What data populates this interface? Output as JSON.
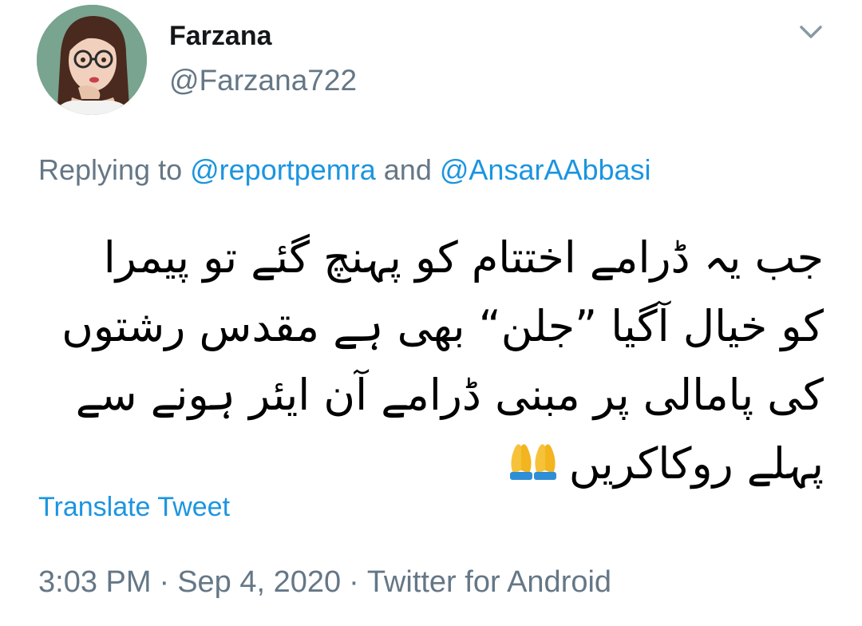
{
  "author": {
    "display_name": "Farzana",
    "handle": "@Farzana722",
    "avatar_icon": "profile-avatar"
  },
  "menu_icon": "chevron-down-icon",
  "reply": {
    "prefix": "Replying to",
    "mention_1": "@reportpemra",
    "conjunction": "and",
    "mention_2": "@AnsarAAbbasi"
  },
  "tweet": {
    "lines": [
      "جب یہ ڈرامے اختتام کو پہنچ گئے تو پیمرا",
      "کو خیال آگیا ”جلن“ بھی ہے مقدس رشتوں",
      "کی پامالی پر مبنی ڈرامے آن ایئر ہونے سے",
      "پہلے روکاکریں"
    ],
    "emoji_icon": "folded-hands-icon"
  },
  "translate_label": "Translate Tweet",
  "meta": {
    "time": "3:03 PM",
    "separator": "·",
    "date": "Sep 4, 2020",
    "source": "Twitter for Android"
  },
  "colors": {
    "link": "#1b95e0",
    "secondary_text": "#657786",
    "primary_text": "#14171a"
  }
}
